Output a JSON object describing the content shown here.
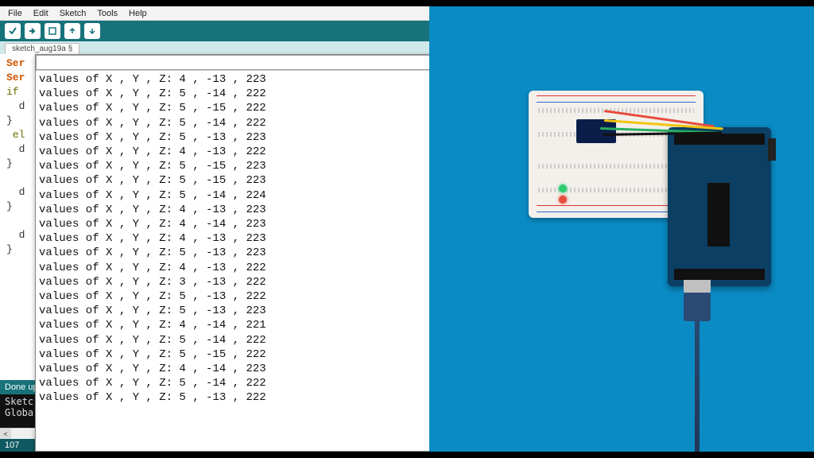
{
  "menu": {
    "file": "File",
    "edit": "Edit",
    "sketch": "Sketch",
    "tools": "Tools",
    "help": "Help"
  },
  "toolbar": {
    "verify": "verify",
    "upload": "upload",
    "new": "new",
    "open": "open",
    "save": "save"
  },
  "tab": {
    "name": "sketch_aug19a §"
  },
  "editor_fragments": {
    "l1": "Ser",
    "l2": "Ser",
    "l3": "if",
    "l4": "  d",
    "l5": "}",
    "l6": " el",
    "l7": "  d",
    "l8": "}",
    "l9": "",
    "l10": "  d",
    "l11": "}",
    "l12": "",
    "l13": "  d",
    "l14": "}"
  },
  "status": {
    "text": "Done uplo"
  },
  "console": {
    "l1": "Sketc",
    "l2": "Globa"
  },
  "linecount": "107",
  "serial": {
    "input_value": "",
    "lines": [
      "values of X , Y , Z: 4 , -13 , 223",
      "values of X , Y , Z: 5 , -14 , 222",
      "values of X , Y , Z: 5 , -15 , 222",
      "values of X , Y , Z: 5 , -14 , 222",
      "values of X , Y , Z: 5 , -13 , 223",
      "values of X , Y , Z: 4 , -13 , 222",
      "values of X , Y , Z: 5 , -15 , 223",
      "values of X , Y , Z: 5 , -15 , 223",
      "values of X , Y , Z: 5 , -14 , 224",
      "values of X , Y , Z: 4 , -13 , 223",
      "values of X , Y , Z: 4 , -14 , 223",
      "values of X , Y , Z: 4 , -13 , 223",
      "values of X , Y , Z: 5 , -13 , 223",
      "values of X , Y , Z: 4 , -13 , 222",
      "values of X , Y , Z: 3 , -13 , 222",
      "values of X , Y , Z: 5 , -13 , 222",
      "values of X , Y , Z: 5 , -13 , 223",
      "values of X , Y , Z: 4 , -14 , 221",
      "values of X , Y , Z: 5 , -14 , 222",
      "values of X , Y , Z: 5 , -15 , 222",
      "values of X , Y , Z: 4 , -14 , 223",
      "values of X , Y , Z: 5 , -14 , 222",
      "values of X , Y , Z: 5 , -13 , 222"
    ]
  },
  "hardware": {
    "board": "Arduino Uno",
    "sensor": "Accelerometer module on breadboard"
  }
}
